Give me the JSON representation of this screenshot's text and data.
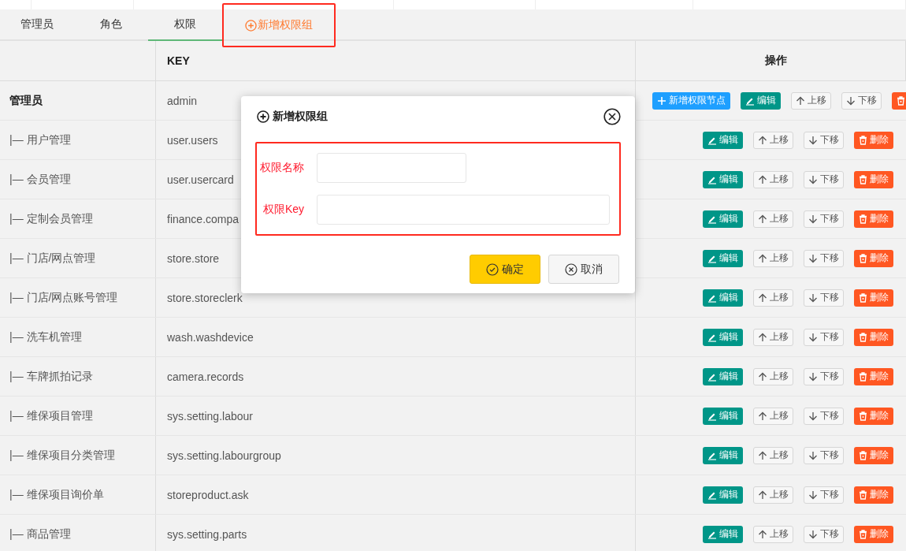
{
  "tabs": [
    {
      "label": "管理员",
      "kind": "tab",
      "selected": false
    },
    {
      "label": "角色",
      "kind": "tab",
      "selected": false
    },
    {
      "label": "权限",
      "kind": "tab",
      "selected": true
    },
    {
      "label": "新增权限组",
      "kind": "action",
      "selected": false,
      "highlighted": true
    }
  ],
  "table": {
    "columns": [
      "",
      "KEY",
      "操作"
    ],
    "rows": [
      {
        "name": "管理员",
        "group": true,
        "key": "admin",
        "buttons": [
          {
            "kind": "add",
            "label": "新增权限节点"
          },
          {
            "kind": "edit",
            "label": "编辑"
          },
          {
            "kind": "up",
            "label": "上移"
          },
          {
            "kind": "down",
            "label": "下移"
          },
          {
            "kind": "delete"
          }
        ]
      },
      {
        "name": "|— 用户管理",
        "group": false,
        "key": "user.users",
        "buttons": [
          {
            "kind": "edit",
            "label": "编辑"
          },
          {
            "kind": "up",
            "label": "上移"
          },
          {
            "kind": "down",
            "label": "下移"
          },
          {
            "kind": "delete",
            "label": "删除"
          }
        ]
      },
      {
        "name": "|— 会员管理",
        "group": false,
        "key": "user.usercard",
        "buttons": [
          {
            "kind": "edit",
            "label": "编辑"
          },
          {
            "kind": "up",
            "label": "上移"
          },
          {
            "kind": "down",
            "label": "下移"
          },
          {
            "kind": "delete",
            "label": "删除"
          }
        ]
      },
      {
        "name": "|— 定制会员管理",
        "group": false,
        "key": "finance.compa",
        "buttons": [
          {
            "kind": "edit",
            "label": "编辑"
          },
          {
            "kind": "up",
            "label": "上移"
          },
          {
            "kind": "down",
            "label": "下移"
          },
          {
            "kind": "delete",
            "label": "删除"
          }
        ]
      },
      {
        "name": "|— 门店/网点管理",
        "group": false,
        "key": "store.store",
        "buttons": [
          {
            "kind": "edit",
            "label": "编辑"
          },
          {
            "kind": "up",
            "label": "上移"
          },
          {
            "kind": "down",
            "label": "下移"
          },
          {
            "kind": "delete",
            "label": "删除"
          }
        ]
      },
      {
        "name": "|— 门店/网点账号管理",
        "group": false,
        "key": "store.storeclerk",
        "buttons": [
          {
            "kind": "edit",
            "label": "编辑"
          },
          {
            "kind": "up",
            "label": "上移"
          },
          {
            "kind": "down",
            "label": "下移"
          },
          {
            "kind": "delete",
            "label": "删除"
          }
        ]
      },
      {
        "name": "|— 洗车机管理",
        "group": false,
        "key": "wash.washdevice",
        "buttons": [
          {
            "kind": "edit",
            "label": "编辑"
          },
          {
            "kind": "up",
            "label": "上移"
          },
          {
            "kind": "down",
            "label": "下移"
          },
          {
            "kind": "delete",
            "label": "删除"
          }
        ]
      },
      {
        "name": "|— 车牌抓拍记录",
        "group": false,
        "key": "camera.records",
        "buttons": [
          {
            "kind": "edit",
            "label": "编辑"
          },
          {
            "kind": "up",
            "label": "上移"
          },
          {
            "kind": "down",
            "label": "下移"
          },
          {
            "kind": "delete",
            "label": "删除"
          }
        ]
      },
      {
        "name": "|— 维保项目管理",
        "group": false,
        "key": "sys.setting.labour",
        "buttons": [
          {
            "kind": "edit",
            "label": "编辑"
          },
          {
            "kind": "up",
            "label": "上移"
          },
          {
            "kind": "down",
            "label": "下移"
          },
          {
            "kind": "delete",
            "label": "删除"
          }
        ]
      },
      {
        "name": "|— 维保项目分类管理",
        "group": false,
        "key": "sys.setting.labourgroup",
        "buttons": [
          {
            "kind": "edit",
            "label": "编辑"
          },
          {
            "kind": "up",
            "label": "上移"
          },
          {
            "kind": "down",
            "label": "下移"
          },
          {
            "kind": "delete",
            "label": "删除"
          }
        ]
      },
      {
        "name": "|— 维保项目询价单",
        "group": false,
        "key": "storeproduct.ask",
        "buttons": [
          {
            "kind": "edit",
            "label": "编辑"
          },
          {
            "kind": "up",
            "label": "上移"
          },
          {
            "kind": "down",
            "label": "下移"
          },
          {
            "kind": "delete",
            "label": "删除"
          }
        ]
      },
      {
        "name": "|— 商品管理",
        "group": false,
        "key": "sys.setting.parts",
        "buttons": [
          {
            "kind": "edit",
            "label": "编辑"
          },
          {
            "kind": "up",
            "label": "上移"
          },
          {
            "kind": "down",
            "label": "下移"
          },
          {
            "kind": "delete",
            "label": "删除"
          }
        ]
      }
    ]
  },
  "dialog": {
    "title": "新增权限组",
    "form_highlighted": true,
    "fields": [
      {
        "label": "权限名称",
        "kind": "short"
      },
      {
        "label": "权限Key",
        "kind": "wide"
      }
    ],
    "buttons": [
      {
        "kind": "confirm",
        "label": "确定"
      },
      {
        "kind": "cancel",
        "label": "取消"
      }
    ]
  }
}
